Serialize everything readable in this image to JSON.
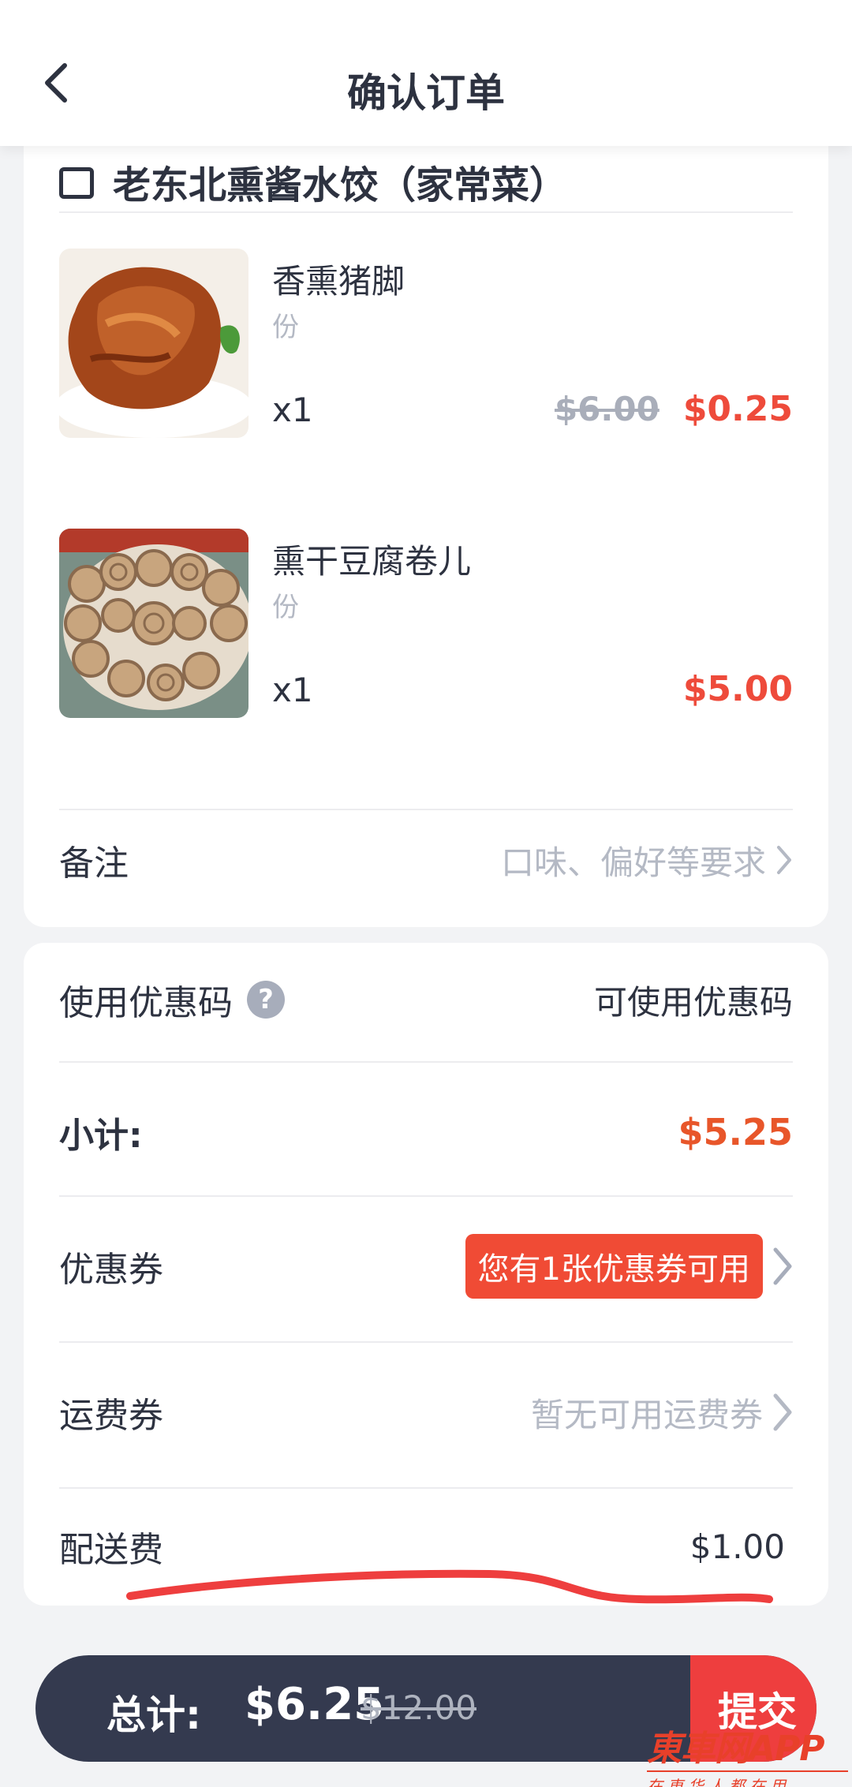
{
  "header": {
    "title": "确认订单"
  },
  "shop": {
    "name": "老东北熏酱水饺（家常菜）"
  },
  "items": [
    {
      "name": "香熏猪脚",
      "unit": "份",
      "qty": "x1",
      "original_price": "$6.00",
      "price": "$0.25"
    },
    {
      "name": "熏干豆腐卷儿",
      "unit": "份",
      "qty": "x1",
      "original_price": "",
      "price": "$5.00"
    }
  ],
  "remark": {
    "label": "备注",
    "placeholder": "口味、偏好等要求"
  },
  "promo": {
    "label": "使用优惠码",
    "help": "?",
    "value": "可使用优惠码"
  },
  "subtotal": {
    "label": "小计:",
    "value": "$5.25"
  },
  "coupon": {
    "label": "优惠券",
    "badge": "您有1张优惠券可用"
  },
  "shipping_coupon": {
    "label": "运费券",
    "value": "暂无可用运费券"
  },
  "delivery": {
    "label": "配送费",
    "value": "$1.00"
  },
  "footer": {
    "total_label": "总计:",
    "total_value": "$6.25",
    "total_original": "$12.00",
    "submit": "提交"
  },
  "watermark": {
    "brand": "東車网APP",
    "tagline": "在東华人都在用"
  },
  "colors": {
    "accent_red": "#ee4b3b",
    "subtotal_orange": "#e8562a",
    "bar_dark": "#343a4f",
    "badge_red": "#f04b35"
  }
}
